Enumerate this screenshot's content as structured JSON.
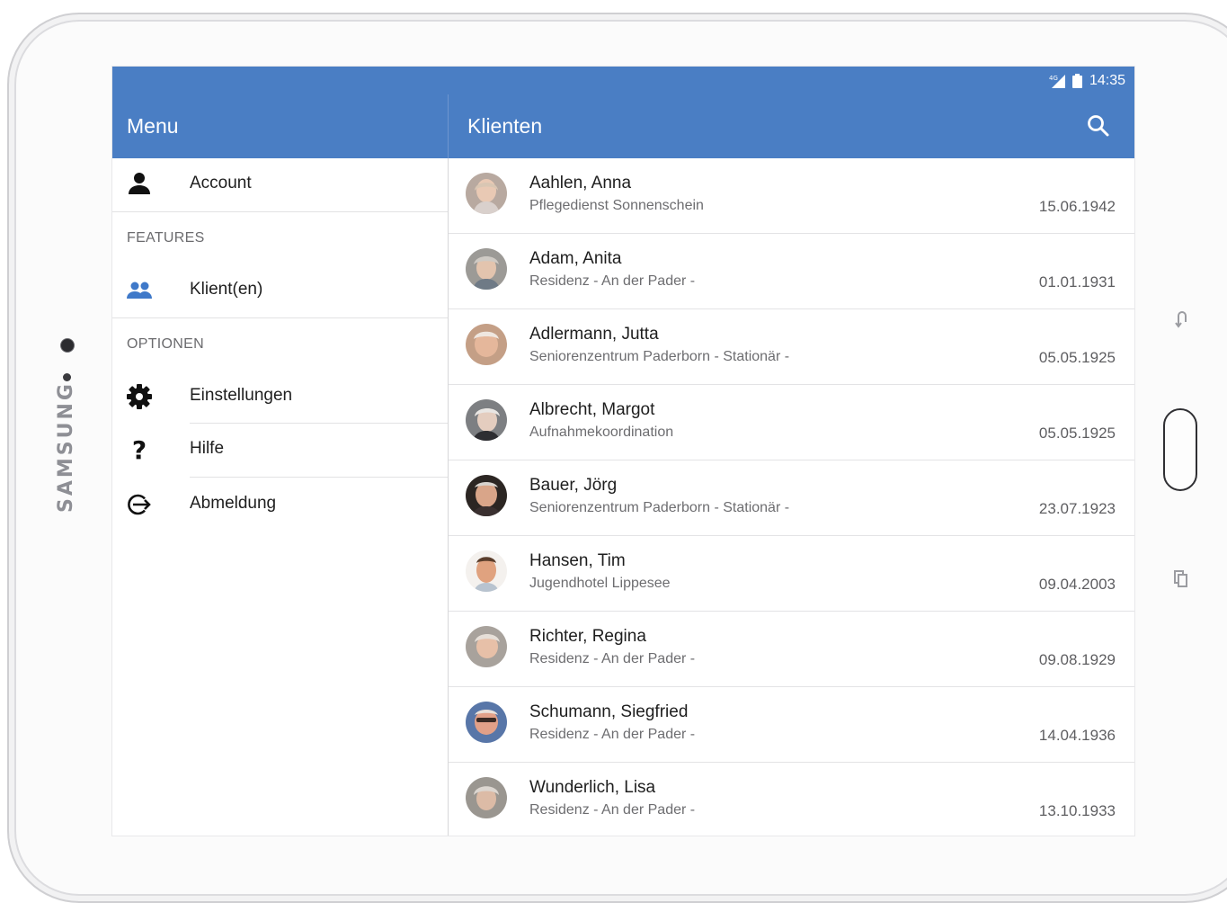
{
  "device": {
    "brand": "SAMSUNG"
  },
  "status_bar": {
    "network": "4G",
    "time": "14:35"
  },
  "drawer": {
    "title": "Menu",
    "account_label": "Account",
    "features_header": "FEATURES",
    "clients_label": "Klient(en)",
    "options_header": "OPTIONEN",
    "settings_label": "Einstellungen",
    "help_label": "Hilfe",
    "logout_label": "Abmeldung"
  },
  "main": {
    "title": "Klienten",
    "clients": [
      {
        "name": "Aahlen, Anna",
        "org": "Pflegedienst Sonnenschein",
        "dob": "15.06.1942"
      },
      {
        "name": "Adam, Anita",
        "org": "Residenz - An der Pader -",
        "dob": "01.01.1931"
      },
      {
        "name": "Adlermann, Jutta",
        "org": "Seniorenzentrum Paderborn - Stationär -",
        "dob": "05.05.1925"
      },
      {
        "name": "Albrecht, Margot",
        "org": "Aufnahmekoordination",
        "dob": "05.05.1925"
      },
      {
        "name": "Bauer, Jörg",
        "org": "Seniorenzentrum Paderborn - Stationär -",
        "dob": "23.07.1923"
      },
      {
        "name": "Hansen, Tim",
        "org": "Jugendhotel Lippesee",
        "dob": "09.04.2003"
      },
      {
        "name": "Richter, Regina",
        "org": "Residenz - An der Pader -",
        "dob": "09.08.1929"
      },
      {
        "name": "Schumann, Siegfried",
        "org": "Residenz - An der Pader -",
        "dob": "14.04.1936"
      },
      {
        "name": "Wunderlich, Lisa",
        "org": "Residenz - An der Pader -",
        "dob": "13.10.1933"
      }
    ]
  },
  "colors": {
    "primary": "#4a7ec4",
    "accent_icon": "#3f79c9",
    "text": "#1e1e1e",
    "secondary_text": "#6d6d70"
  },
  "icons": {
    "account": "person-icon",
    "clients": "people-icon",
    "settings": "gear-icon",
    "help": "question-mark-icon",
    "logout": "logout-icon",
    "search": "search-icon"
  }
}
